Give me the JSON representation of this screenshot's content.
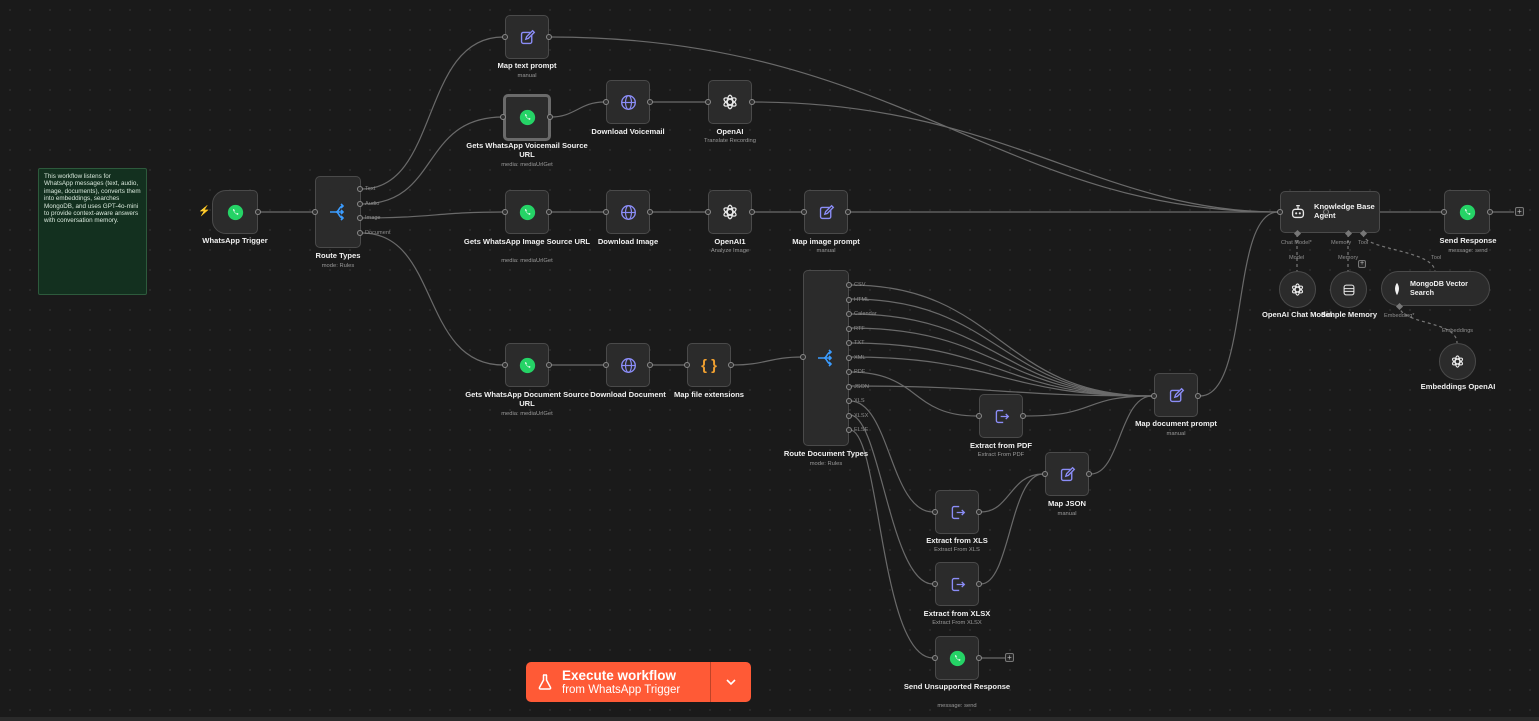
{
  "note": {
    "text": "This workflow listens for WhatsApp messages (text, audio, image, documents), converts them into embeddings, searches MongoDB, and uses GPT-4o-mini to provide context-aware answers with conversation memory."
  },
  "nodes": {
    "whatsapp_trigger": {
      "label": "WhatsApp Trigger"
    },
    "route_types": {
      "label": "Route Types",
      "sub": "mode: Rules",
      "outputs": [
        "Text",
        "Audio",
        "Image",
        "Document"
      ]
    },
    "map_text_prompt": {
      "label": "Map text prompt",
      "sub": "manual"
    },
    "gets_voicemail": {
      "label": "Gets WhatsApp Voicemail Source URL",
      "sub": "media: mediaUrlGet"
    },
    "download_voicemail": {
      "label": "Download Voicemail"
    },
    "openai": {
      "label": "OpenAI",
      "sub": "Translate Recording"
    },
    "gets_image": {
      "label": "Gets WhatsApp Image Source URL",
      "sub": "media: mediaUrlGet"
    },
    "download_image": {
      "label": "Download Image"
    },
    "openai1": {
      "label": "OpenAI1",
      "sub": "Analyze Image"
    },
    "map_image_prompt": {
      "label": "Map image prompt",
      "sub": "manual"
    },
    "gets_document": {
      "label": "Gets WhatsApp Document Source URL",
      "sub": "media: mediaUrlGet"
    },
    "download_document": {
      "label": "Download Document"
    },
    "map_file_ext": {
      "label": "Map file extensions"
    },
    "route_doc_types": {
      "label": "Route Document Types",
      "sub": "mode: Rules",
      "outputs": [
        "CSV",
        "HTML",
        "Calendar",
        "RTF",
        "TXT",
        "XML",
        "PDF",
        "JSON",
        "XLS",
        "XLSX",
        "ELSE"
      ]
    },
    "extract_pdf": {
      "label": "Extract from PDF",
      "sub": "Extract From PDF"
    },
    "extract_xls": {
      "label": "Extract from XLS",
      "sub": "Extract From XLS"
    },
    "extract_xlsx": {
      "label": "Extract from XLSX",
      "sub": "Extract From XLSX"
    },
    "send_unsupported": {
      "label": "Send Unsupported Response",
      "sub": "message: send"
    },
    "map_json": {
      "label": "Map JSON",
      "sub": "manual"
    },
    "map_doc_prompt": {
      "label": "Map document prompt",
      "sub": "manual"
    },
    "kb_agent": {
      "label": "Knowledge Base Agent",
      "ports": [
        "Chat Model*",
        "Memory",
        "Tool"
      ]
    },
    "send_response": {
      "label": "Send Response",
      "sub": "message: send"
    },
    "openai_chat": {
      "label": "OpenAI Chat Model"
    },
    "simple_memory": {
      "label": "Simple Memory"
    },
    "mongodb": {
      "label": "MongoDB Vector Search",
      "port": "Embedding*"
    },
    "embeddings": {
      "label": "Embeddings OpenAI"
    }
  },
  "edge_labels": {
    "model": "Model",
    "memory": "Memory",
    "tool": "Tool",
    "embeddings": "Embeddings"
  },
  "execute": {
    "line1": "Execute workflow",
    "line2": "from WhatsApp Trigger"
  },
  "colors": {
    "background": "#1a1a1a",
    "accent": "#ff5a36",
    "whatsapp": "#25d366",
    "http": "#7a7cf0",
    "note": "#13301f"
  }
}
